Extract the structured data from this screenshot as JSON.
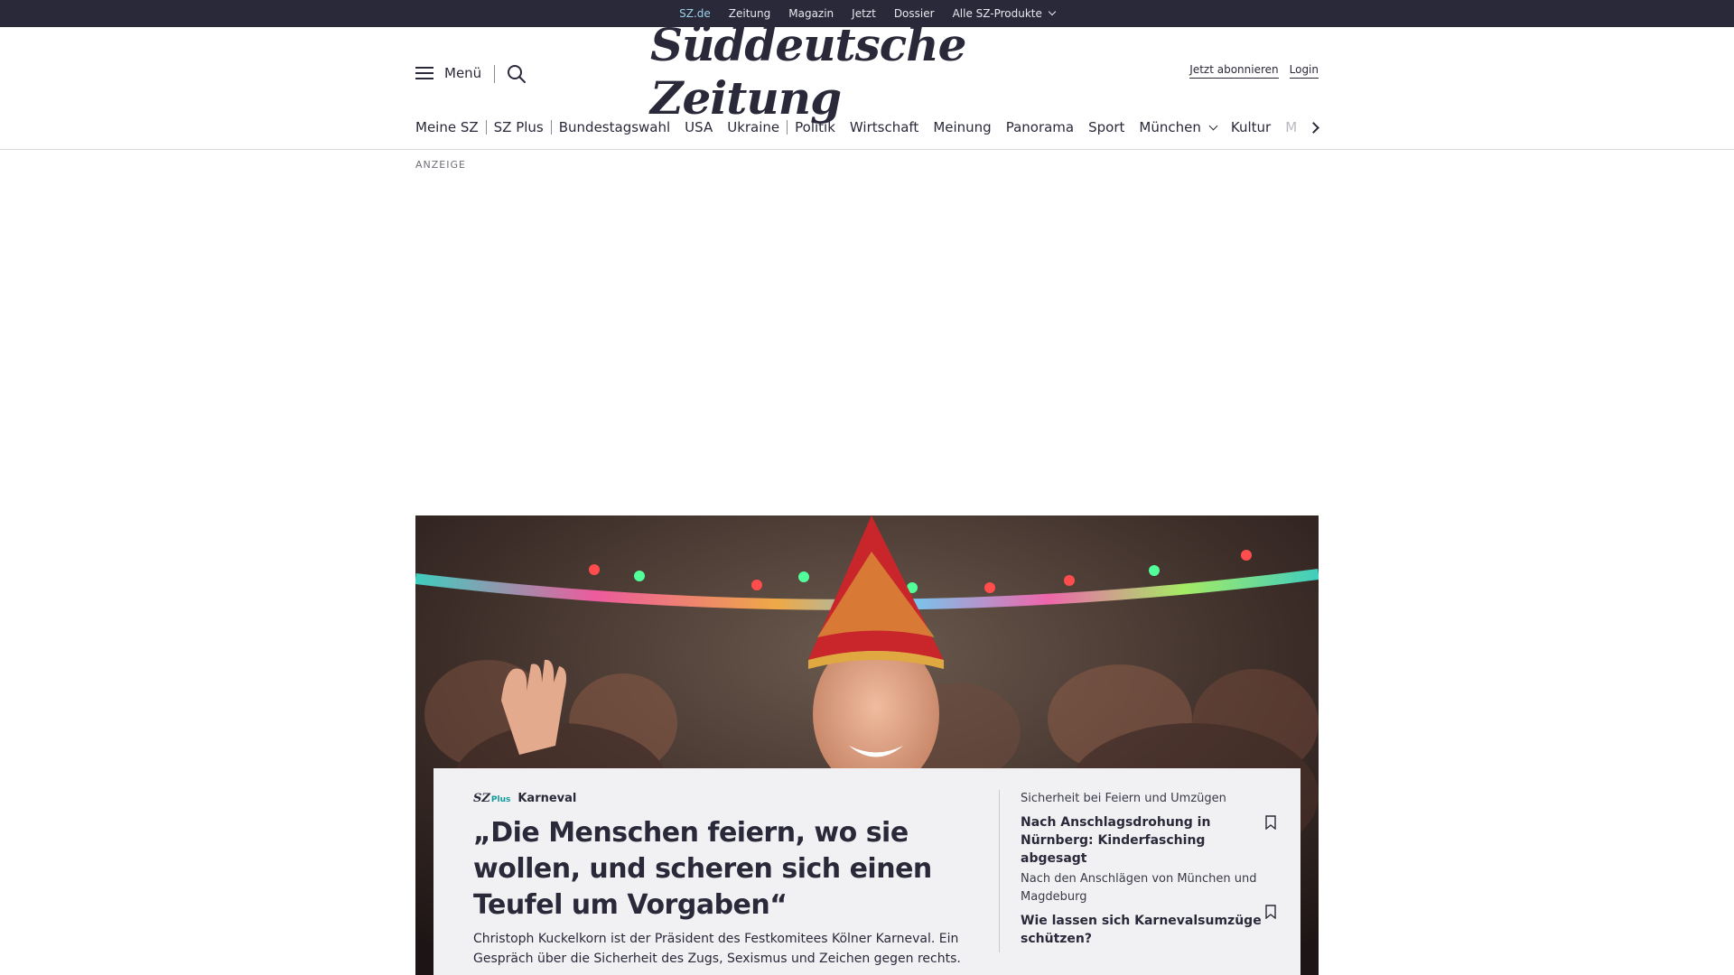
{
  "topnav": {
    "items": [
      "SZ.de",
      "Zeitung",
      "Magazin",
      "Jetzt",
      "Dossier",
      "Alle SZ-Produkte"
    ]
  },
  "header": {
    "menu_label": "Menü",
    "logo_text": "Süddeutsche Zeitung",
    "subscribe_label": "Jetzt abonnieren",
    "login_label": "Login"
  },
  "categories": [
    "Meine SZ",
    "SZ Plus",
    "Bundestagswahl",
    "USA",
    "Ukraine",
    "Politik",
    "Wirtschaft",
    "Meinung",
    "Panorama",
    "Sport",
    "München",
    "Kultur",
    "M"
  ],
  "ad_label": "ANZEIGE",
  "hero": {
    "brand": "SZ",
    "brand_plus": "Plus",
    "topic": "Karneval",
    "headline": "„Die Menschen feiern, wo sie wollen, und scheren sich einen Teufel um Vorgaben“",
    "teaser": "Christoph Kuckelkorn ist der Präsident des Festkomitees Kölner Karneval. Ein Gespräch über die Sicherheit des Zugs, Sexismus und Zeichen gegen rechts."
  },
  "side_articles": [
    {
      "overline": "Sicherheit bei Feiern und Umzügen",
      "title": "Nach Anschlagsdrohung in Nürnberg: Kinderfasching abgesagt"
    },
    {
      "overline": "Nach den Anschlägen von München und Magdeburg",
      "title": "Wie lassen sich Karnevalsumzüge schützen?"
    }
  ],
  "colors": {
    "topbar": "#29293a",
    "text": "#29293a",
    "active_top": "#9bd2e8",
    "card_bg": "#f1f1f3",
    "plus_accent": "#0e9a9a"
  }
}
